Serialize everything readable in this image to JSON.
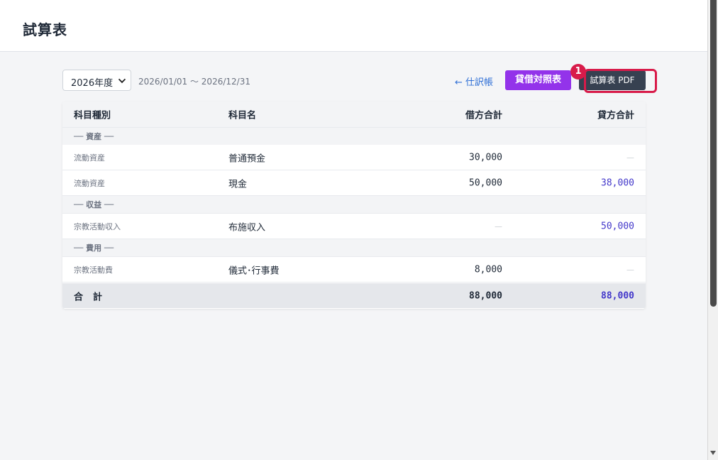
{
  "header": {
    "title": "試算表"
  },
  "toolbar": {
    "year_select": "2026年度",
    "period": "2026/01/01 〜 2026/12/31",
    "journal_link": "← 仕訳帳",
    "balance_sheet_button": "貸借対照表",
    "pdf_button": "試算表 PDF",
    "marker": "1"
  },
  "colors": {
    "accent_purple": "#9333ea",
    "dark_button": "#374151",
    "credit_text": "#4338ca",
    "highlight": "#d81b4a"
  },
  "table": {
    "headers": {
      "type": "科目種別",
      "name": "科目名",
      "debit": "借方合計",
      "credit": "貸方合計"
    },
    "groups": {
      "assets": "── 資産 ──",
      "revenue": "── 収益 ──",
      "expenses": "── 費用 ──"
    },
    "rows": [
      {
        "type": "流動資産",
        "name": "普通預金",
        "debit": "30,000",
        "credit": "—"
      },
      {
        "type": "流動資産",
        "name": "現金",
        "debit": "50,000",
        "credit": "38,000"
      },
      {
        "type": "宗教活動収入",
        "name": "布施収入",
        "debit": "—",
        "credit": "50,000"
      },
      {
        "type": "宗教活動費",
        "name": "儀式･行事費",
        "debit": "8,000",
        "credit": "—"
      }
    ],
    "total": {
      "label": "合計",
      "debit": "88,000",
      "credit": "88,000"
    }
  }
}
